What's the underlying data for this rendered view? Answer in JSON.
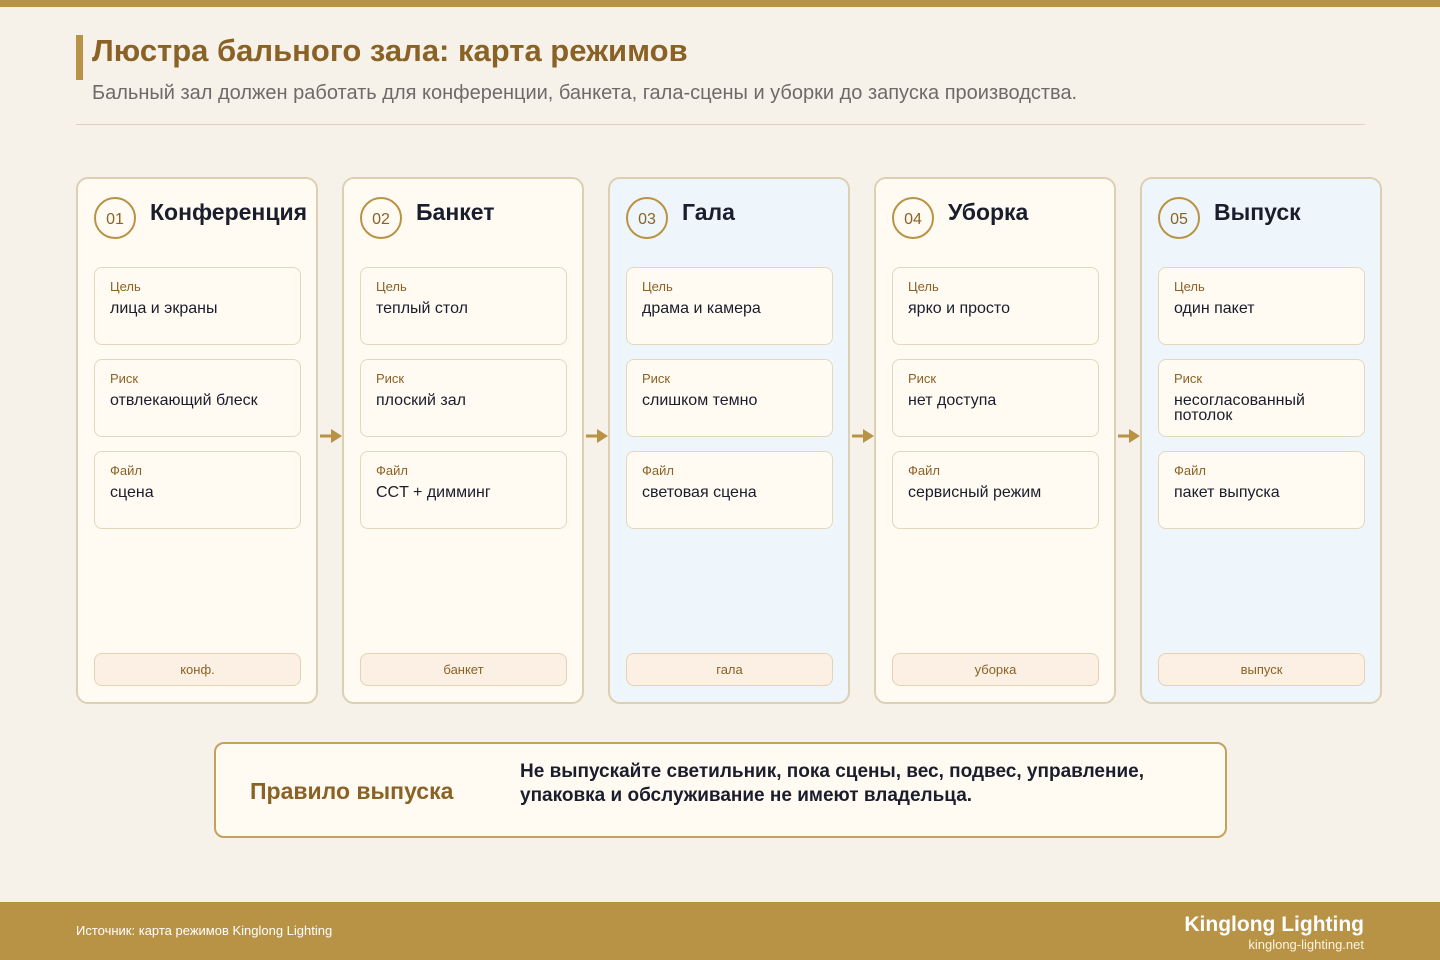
{
  "header": {
    "title": "Люстра бального зала: карта режимов",
    "subtitle": "Бальный зал должен работать для конференции, банкета, гала-сцены и уборки до запуска производства."
  },
  "field_labels": {
    "goal": "Цель",
    "risk": "Риск",
    "file": "Файл"
  },
  "modes": [
    {
      "number": "01",
      "title": "Конференция",
      "goal": "лица и экраны",
      "risk": "отвлекающий блеск",
      "file": "сцена",
      "tag": "конф.",
      "highlight": false
    },
    {
      "number": "02",
      "title": "Банкет",
      "goal": "теплый стол",
      "risk": "плоский зал",
      "file": "CCT + димминг",
      "tag": "банкет",
      "highlight": false
    },
    {
      "number": "03",
      "title": "Гала",
      "goal": "драма и камера",
      "risk": "слишком темно",
      "file": "световая сцена",
      "tag": "гала",
      "highlight": true
    },
    {
      "number": "04",
      "title": "Уборка",
      "goal": "ярко и просто",
      "risk": "нет доступа",
      "file": "сервисный режим",
      "tag": "уборка",
      "highlight": false
    },
    {
      "number": "05",
      "title": "Выпуск",
      "goal": "один пакет",
      "risk": "несогласованный потолок",
      "file": "пакет выпуска",
      "tag": "выпуск",
      "highlight": true
    }
  ],
  "release_rule": {
    "label": "Правило выпуска",
    "text": "Не выпускайте светильник, пока сцены, вес, подвес, управление, упаковка и обслуживание не имеют владельца."
  },
  "footer": {
    "source": "Источник: карта режимов Kinglong Lighting",
    "brand": "Kinglong Lighting",
    "url": "kinglong-lighting.net"
  },
  "colors": {
    "accent": "#b99345",
    "accent_dark": "#8a6225",
    "card_bg": "#fffbf3",
    "card_highlight_bg": "#eef6fb",
    "page_bg": "#f6f2ea"
  },
  "icons": {
    "flow_arrow": "arrow-right-icon"
  }
}
